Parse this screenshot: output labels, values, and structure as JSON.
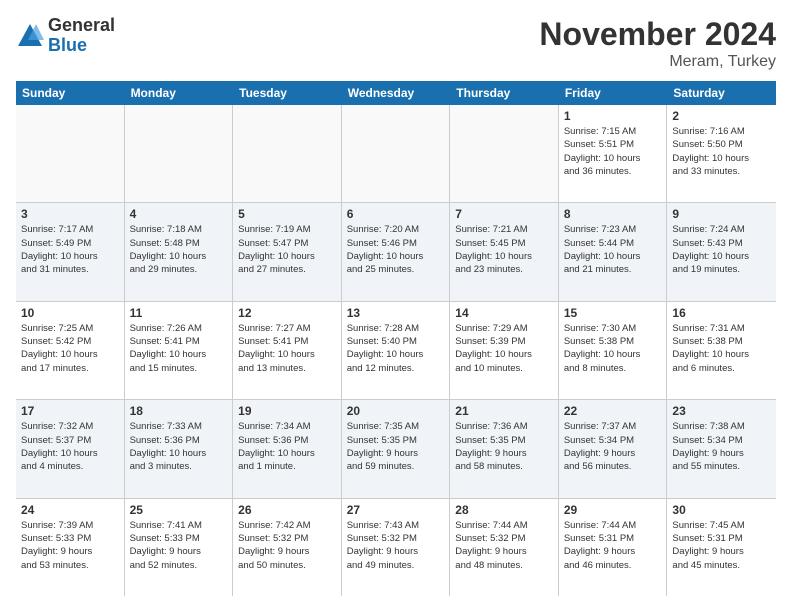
{
  "logo": {
    "general": "General",
    "blue": "Blue"
  },
  "title": {
    "month": "November 2024",
    "location": "Meram, Turkey"
  },
  "header_days": [
    "Sunday",
    "Monday",
    "Tuesday",
    "Wednesday",
    "Thursday",
    "Friday",
    "Saturday"
  ],
  "weeks": [
    [
      {
        "day": "",
        "info": ""
      },
      {
        "day": "",
        "info": ""
      },
      {
        "day": "",
        "info": ""
      },
      {
        "day": "",
        "info": ""
      },
      {
        "day": "",
        "info": ""
      },
      {
        "day": "1",
        "info": "Sunrise: 7:15 AM\nSunset: 5:51 PM\nDaylight: 10 hours\nand 36 minutes."
      },
      {
        "day": "2",
        "info": "Sunrise: 7:16 AM\nSunset: 5:50 PM\nDaylight: 10 hours\nand 33 minutes."
      }
    ],
    [
      {
        "day": "3",
        "info": "Sunrise: 7:17 AM\nSunset: 5:49 PM\nDaylight: 10 hours\nand 31 minutes."
      },
      {
        "day": "4",
        "info": "Sunrise: 7:18 AM\nSunset: 5:48 PM\nDaylight: 10 hours\nand 29 minutes."
      },
      {
        "day": "5",
        "info": "Sunrise: 7:19 AM\nSunset: 5:47 PM\nDaylight: 10 hours\nand 27 minutes."
      },
      {
        "day": "6",
        "info": "Sunrise: 7:20 AM\nSunset: 5:46 PM\nDaylight: 10 hours\nand 25 minutes."
      },
      {
        "day": "7",
        "info": "Sunrise: 7:21 AM\nSunset: 5:45 PM\nDaylight: 10 hours\nand 23 minutes."
      },
      {
        "day": "8",
        "info": "Sunrise: 7:23 AM\nSunset: 5:44 PM\nDaylight: 10 hours\nand 21 minutes."
      },
      {
        "day": "9",
        "info": "Sunrise: 7:24 AM\nSunset: 5:43 PM\nDaylight: 10 hours\nand 19 minutes."
      }
    ],
    [
      {
        "day": "10",
        "info": "Sunrise: 7:25 AM\nSunset: 5:42 PM\nDaylight: 10 hours\nand 17 minutes."
      },
      {
        "day": "11",
        "info": "Sunrise: 7:26 AM\nSunset: 5:41 PM\nDaylight: 10 hours\nand 15 minutes."
      },
      {
        "day": "12",
        "info": "Sunrise: 7:27 AM\nSunset: 5:41 PM\nDaylight: 10 hours\nand 13 minutes."
      },
      {
        "day": "13",
        "info": "Sunrise: 7:28 AM\nSunset: 5:40 PM\nDaylight: 10 hours\nand 12 minutes."
      },
      {
        "day": "14",
        "info": "Sunrise: 7:29 AM\nSunset: 5:39 PM\nDaylight: 10 hours\nand 10 minutes."
      },
      {
        "day": "15",
        "info": "Sunrise: 7:30 AM\nSunset: 5:38 PM\nDaylight: 10 hours\nand 8 minutes."
      },
      {
        "day": "16",
        "info": "Sunrise: 7:31 AM\nSunset: 5:38 PM\nDaylight: 10 hours\nand 6 minutes."
      }
    ],
    [
      {
        "day": "17",
        "info": "Sunrise: 7:32 AM\nSunset: 5:37 PM\nDaylight: 10 hours\nand 4 minutes."
      },
      {
        "day": "18",
        "info": "Sunrise: 7:33 AM\nSunset: 5:36 PM\nDaylight: 10 hours\nand 3 minutes."
      },
      {
        "day": "19",
        "info": "Sunrise: 7:34 AM\nSunset: 5:36 PM\nDaylight: 10 hours\nand 1 minute."
      },
      {
        "day": "20",
        "info": "Sunrise: 7:35 AM\nSunset: 5:35 PM\nDaylight: 9 hours\nand 59 minutes."
      },
      {
        "day": "21",
        "info": "Sunrise: 7:36 AM\nSunset: 5:35 PM\nDaylight: 9 hours\nand 58 minutes."
      },
      {
        "day": "22",
        "info": "Sunrise: 7:37 AM\nSunset: 5:34 PM\nDaylight: 9 hours\nand 56 minutes."
      },
      {
        "day": "23",
        "info": "Sunrise: 7:38 AM\nSunset: 5:34 PM\nDaylight: 9 hours\nand 55 minutes."
      }
    ],
    [
      {
        "day": "24",
        "info": "Sunrise: 7:39 AM\nSunset: 5:33 PM\nDaylight: 9 hours\nand 53 minutes."
      },
      {
        "day": "25",
        "info": "Sunrise: 7:41 AM\nSunset: 5:33 PM\nDaylight: 9 hours\nand 52 minutes."
      },
      {
        "day": "26",
        "info": "Sunrise: 7:42 AM\nSunset: 5:32 PM\nDaylight: 9 hours\nand 50 minutes."
      },
      {
        "day": "27",
        "info": "Sunrise: 7:43 AM\nSunset: 5:32 PM\nDaylight: 9 hours\nand 49 minutes."
      },
      {
        "day": "28",
        "info": "Sunrise: 7:44 AM\nSunset: 5:32 PM\nDaylight: 9 hours\nand 48 minutes."
      },
      {
        "day": "29",
        "info": "Sunrise: 7:44 AM\nSunset: 5:31 PM\nDaylight: 9 hours\nand 46 minutes."
      },
      {
        "day": "30",
        "info": "Sunrise: 7:45 AM\nSunset: 5:31 PM\nDaylight: 9 hours\nand 45 minutes."
      }
    ]
  ]
}
